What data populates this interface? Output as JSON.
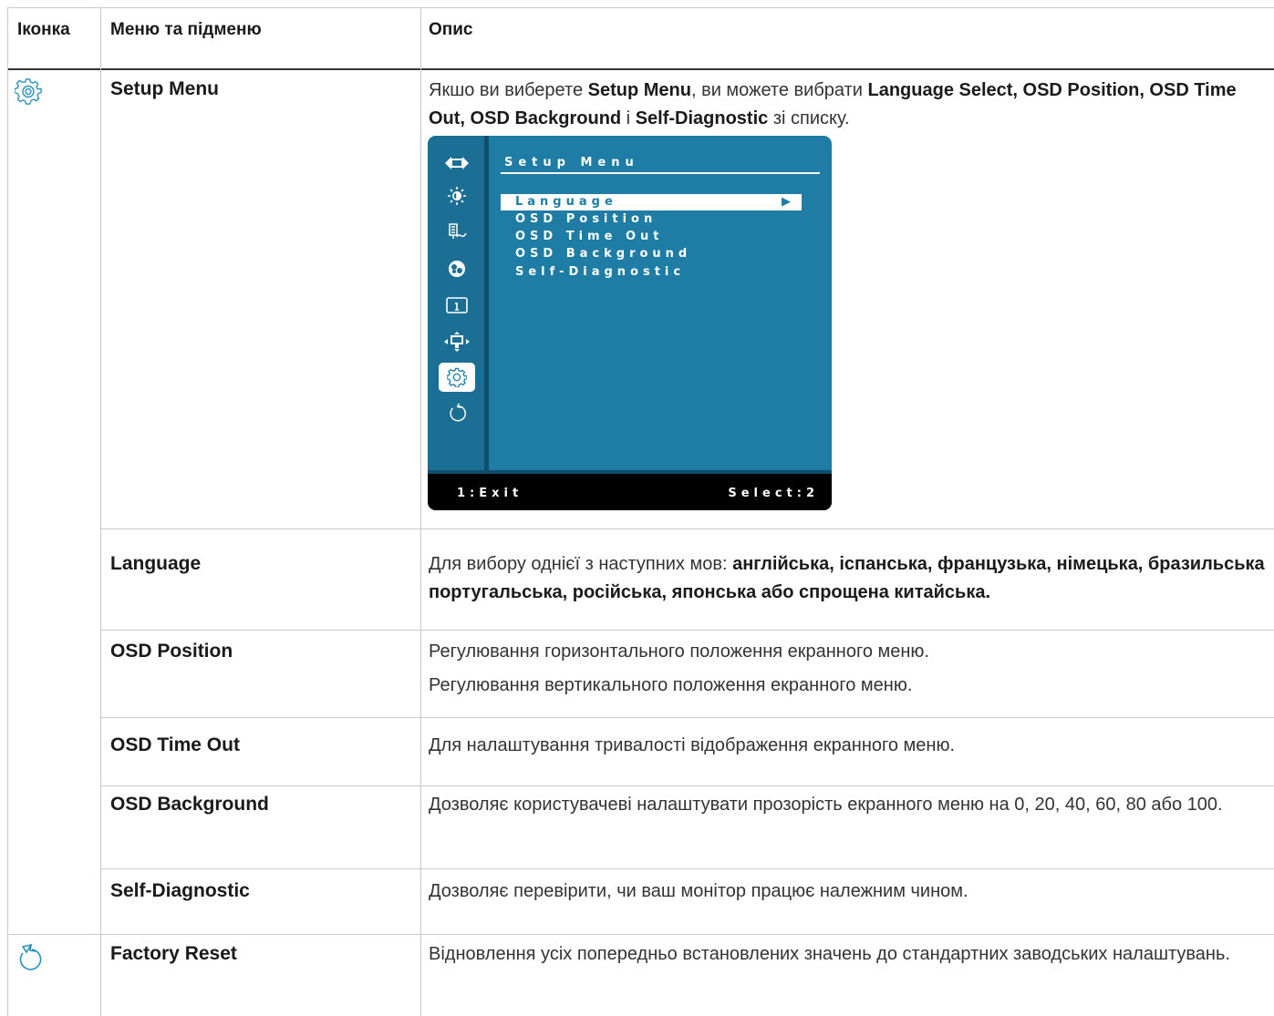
{
  "headers": {
    "icon": "Іконка",
    "menu": "Меню та підменю",
    "desc": "Опис"
  },
  "rows": {
    "setup": {
      "name": "Setup Menu",
      "desc_parts": [
        "Якшо ви виберете ",
        "Setup Menu",
        ", ви можете вибрати ",
        "Language Select, OSD Position, OSD Time Out, OSD Background",
        " і ",
        "Self-Diagnostic",
        " зі списку."
      ],
      "icon": "gear-icon"
    },
    "language": {
      "name": "Language",
      "desc_parts": [
        "Для вибору однієї з наступних мов: ",
        "англійська, іспанська, французька, німецька, бразильська португальська, російська, японська або спрощена китайська."
      ]
    },
    "osd_position": {
      "name": "OSD Position",
      "line1": "Регулювання горизонтального положення екранного меню.",
      "line2": "Регулювання вертикального положення екранного меню."
    },
    "osd_timeout": {
      "name": "OSD Time Out",
      "desc": "Для налаштування тривалості відображення екранного меню."
    },
    "osd_background": {
      "name": "OSD Background",
      "desc": "Дозволяє користувачеві налаштувати прозорість екранного меню на 0, 20, 40, 60, 80 або 100."
    },
    "self_diagnostic": {
      "name": "Self-Diagnostic",
      "desc": "Дозволяє перевірити, чи ваш монітор працює належним чином."
    },
    "factory_reset": {
      "name": "Factory Reset",
      "desc": "Відновлення усіх попередньо встановлених значень до стандартних заводських налаштувань.",
      "icon": "reset-icon"
    }
  },
  "osd": {
    "title": "Setup Menu",
    "items": [
      "Language",
      "OSD Position",
      "OSD Time Out",
      "OSD Background",
      "Self-Diagnostic"
    ],
    "selected_arrow": "▶",
    "footer_left": "1:Exit",
    "footer_right": "Select:2",
    "icons": [
      "input-icon",
      "brightness-icon",
      "color-icon",
      "audio-icon",
      "info-icon",
      "display-icon",
      "setup-icon",
      "reset-icon"
    ],
    "colors": {
      "panel": "#1f7da5",
      "sidebar": "#1b6f94",
      "footer": "#000000"
    }
  }
}
